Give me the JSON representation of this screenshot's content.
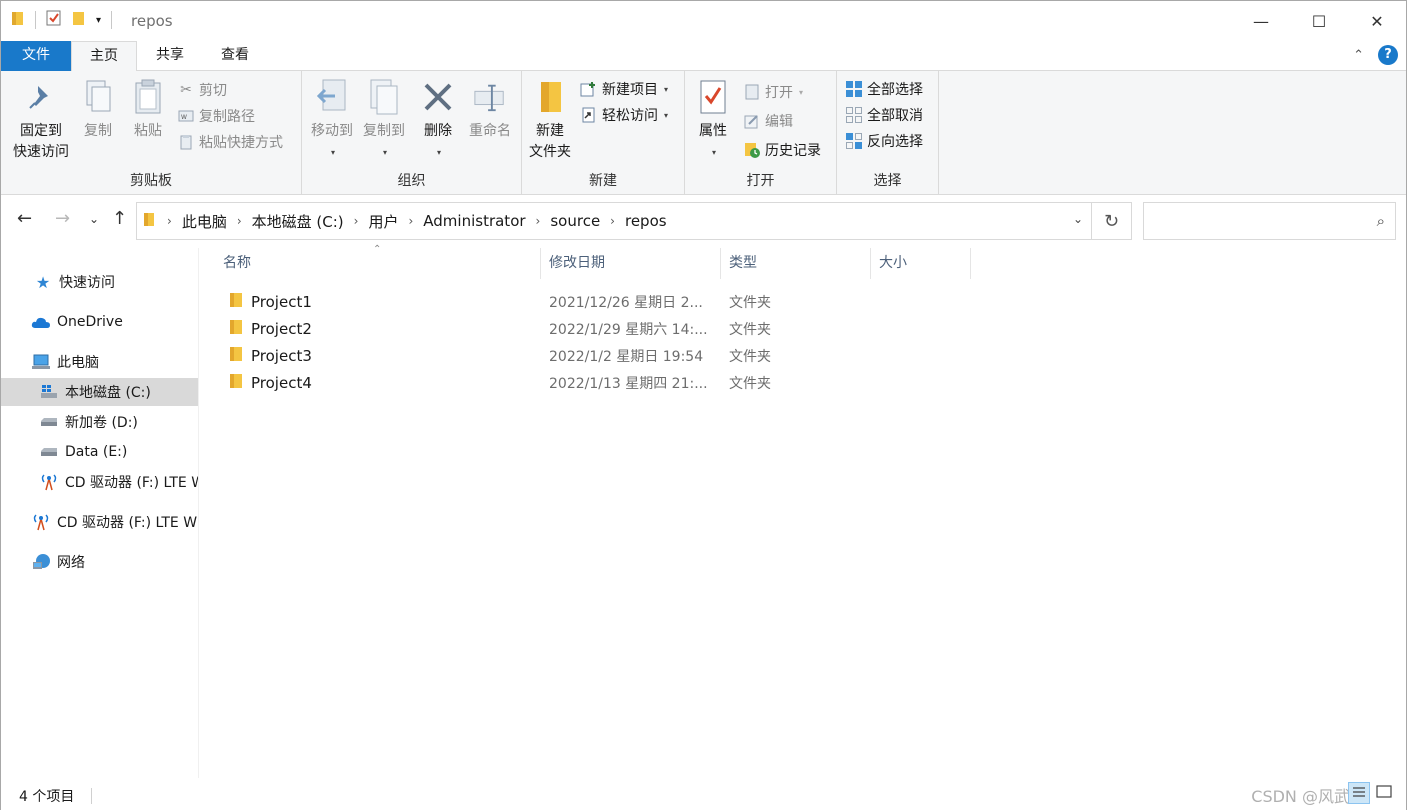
{
  "window": {
    "title": "repos",
    "controls": {
      "minimize": "—",
      "maximize": "☐",
      "close": "✕"
    }
  },
  "tabs": {
    "file": "文件",
    "home": "主页",
    "share": "共享",
    "view": "查看",
    "help": "?"
  },
  "ribbon": {
    "clipboard": {
      "label": "剪贴板",
      "pin_line1": "固定到",
      "pin_line2": "快速访问",
      "copy": "复制",
      "paste": "粘贴",
      "cut": "剪切",
      "copy_path": "复制路径",
      "paste_shortcut": "粘贴快捷方式"
    },
    "organize": {
      "label": "组织",
      "move_to": "移动到",
      "copy_to": "复制到",
      "delete": "删除",
      "rename": "重命名"
    },
    "new": {
      "label": "新建",
      "new_folder_line1": "新建",
      "new_folder_line2": "文件夹",
      "new_item": "新建项目",
      "easy_access": "轻松访问"
    },
    "open": {
      "label": "打开",
      "properties": "属性",
      "open": "打开",
      "edit": "编辑",
      "history": "历史记录"
    },
    "select": {
      "label": "选择",
      "select_all": "全部选择",
      "select_none": "全部取消",
      "invert": "反向选择"
    }
  },
  "address": {
    "crumbs": [
      "此电脑",
      "本地磁盘 (C:)",
      "用户",
      "Administrator",
      "source",
      "repos"
    ],
    "search_placeholder": ""
  },
  "nav": {
    "quick_access": "快速访问",
    "onedrive": "OneDrive",
    "this_pc": "此电脑",
    "local_disk": "本地磁盘 (C:)",
    "new_volume": "新加卷 (D:)",
    "data": "Data (E:)",
    "cd_drive_child": "CD 驱动器 (F:) LTE W",
    "cd_drive": "CD 驱动器 (F:) LTE W",
    "network": "网络"
  },
  "columns": {
    "name": "名称",
    "date": "修改日期",
    "type": "类型",
    "size": "大小"
  },
  "files": [
    {
      "name": "Project1",
      "date": "2021/12/26 星期日 2...",
      "type": "文件夹"
    },
    {
      "name": "Project2",
      "date": "2022/1/29 星期六 14:...",
      "type": "文件夹"
    },
    {
      "name": "Project3",
      "date": "2022/1/2 星期日 19:54",
      "type": "文件夹"
    },
    {
      "name": "Project4",
      "date": "2022/1/13 星期四 21:...",
      "type": "文件夹"
    }
  ],
  "status": {
    "count": "4 个项目",
    "watermark": "CSDN @风武"
  },
  "colors": {
    "accent": "#1979ca",
    "folder": "#f4c542",
    "selected_nav": "#d9d9d9"
  }
}
